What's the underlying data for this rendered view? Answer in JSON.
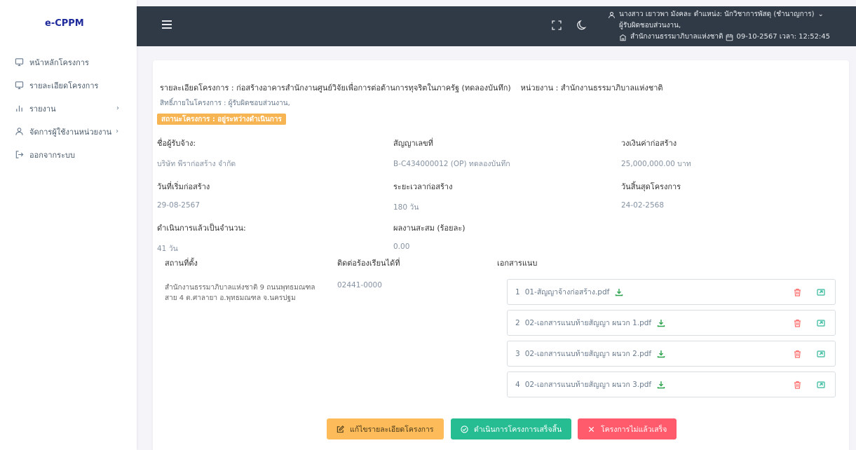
{
  "app": {
    "brand": "e-CPPM"
  },
  "sidebar": {
    "items": [
      {
        "label": "หน้าหลักโครงการ",
        "icon": "monitor-icon"
      },
      {
        "label": "รายละเอียดโครงการ",
        "icon": "monitor-icon"
      },
      {
        "label": "รายงาน",
        "icon": "bar-chart-icon",
        "arrow": "›"
      },
      {
        "label": "จัดการผู้ใช้งานหน่วยงาน",
        "icon": "user-icon",
        "arrow": "›"
      },
      {
        "label": "ออกจากระบบ",
        "icon": "logout-icon"
      }
    ]
  },
  "header": {
    "user_line1": "นางสาว เยาวพา มังคละ ตำแหน่ง: นักวิชาการพัสดุ (ชำนาญการ)",
    "user_line2": "ผู้รับผิดชอบส่วนงาน,",
    "org": "สำนักงานธรรมาภิบาลแห่งชาติ",
    "datetime": "09-10-2567 เวลา: 12:52:45",
    "dropdown_glyph": "⌄"
  },
  "project": {
    "title": "รายละเอียดโครงการ : ก่อสร้างอาคารสำนักงานศูนย์วิจัยเพื่อการต่อต้านการทุจริตในภาครัฐ (ทดลองบันทึก)",
    "unit": "หน่วยงาน : สำนักงานธรรมาภิบาลแห่งชาติ",
    "rights": "สิทธิ์ภายในโครงการ : ผู้รับผิดชอบส่วนงาน,",
    "status": "สถานะโครงการ : อยู่ระหว่างดำเนินการ"
  },
  "fields": {
    "contractor": {
      "label": "ชื่อผู้รับจ้าง:",
      "value": "บริษัท พีราก่อสร้าง จำกัด"
    },
    "contract_no": {
      "label": "สัญญาเลขที่",
      "value": "B-C434000012 (OP) ทดลองบันทึก"
    },
    "budget": {
      "label": "วงเงินค่าก่อสร้าง",
      "value": "25,000,000.00 บาท"
    },
    "start_date": {
      "label": "วันที่เริ่มก่อสร้าง",
      "value": "29-08-2567"
    },
    "duration": {
      "label": "ระยะเวลาก่อสร้าง",
      "value": "180 วัน"
    },
    "end_date": {
      "label": "วันสิ้นสุดโครงการ",
      "value": "24-02-2568"
    },
    "elapsed": {
      "label": "ดำเนินการแล้วเป็นจำนวน:",
      "value": "41 วัน"
    },
    "progress": {
      "label": "ผลงานสะสม (ร้อยละ)",
      "value": "0.00"
    }
  },
  "location": {
    "label": "สถานที่ตั้ง",
    "value": "สำนักงานธรรมาภิบาลแห่งชาติ 9 ถนนพุทธมณฑลสาย 4 ต.ศาลายา อ.พุทธมณฑล จ.นครปฐม"
  },
  "contact": {
    "label": "ติดต่อร้องเรียนได้ที่",
    "value": "02441-0000"
  },
  "attachments": {
    "label": "เอกสารแนบ",
    "items": [
      {
        "num": "1",
        "name": "01-สัญญาจ้างก่อสร้าง.pdf"
      },
      {
        "num": "2",
        "name": "02-เอกสารแนบท้ายสัญญา ผนวก 1.pdf"
      },
      {
        "num": "3",
        "name": "02-เอกสารแนบท้ายสัญญา ผนวก 2.pdf"
      },
      {
        "num": "4",
        "name": "02-เอกสารแนบท้ายสัญญา ผนวก 3.pdf"
      }
    ]
  },
  "actions": {
    "edit": "แก้ไขรายละเอียดโครงการ",
    "complete": "ดำเนินการโครงการเสร็จสิ้น",
    "incomplete": "โครงการไม่แล้วเสร็จ"
  },
  "colors": {
    "topbar": "#2f3a46",
    "brand": "#1e2a9b",
    "status_badge": "#f6b452",
    "edit_button": "#fdbb59",
    "complete_button": "#26bd92",
    "incomplete_button": "#ff5b6c"
  }
}
